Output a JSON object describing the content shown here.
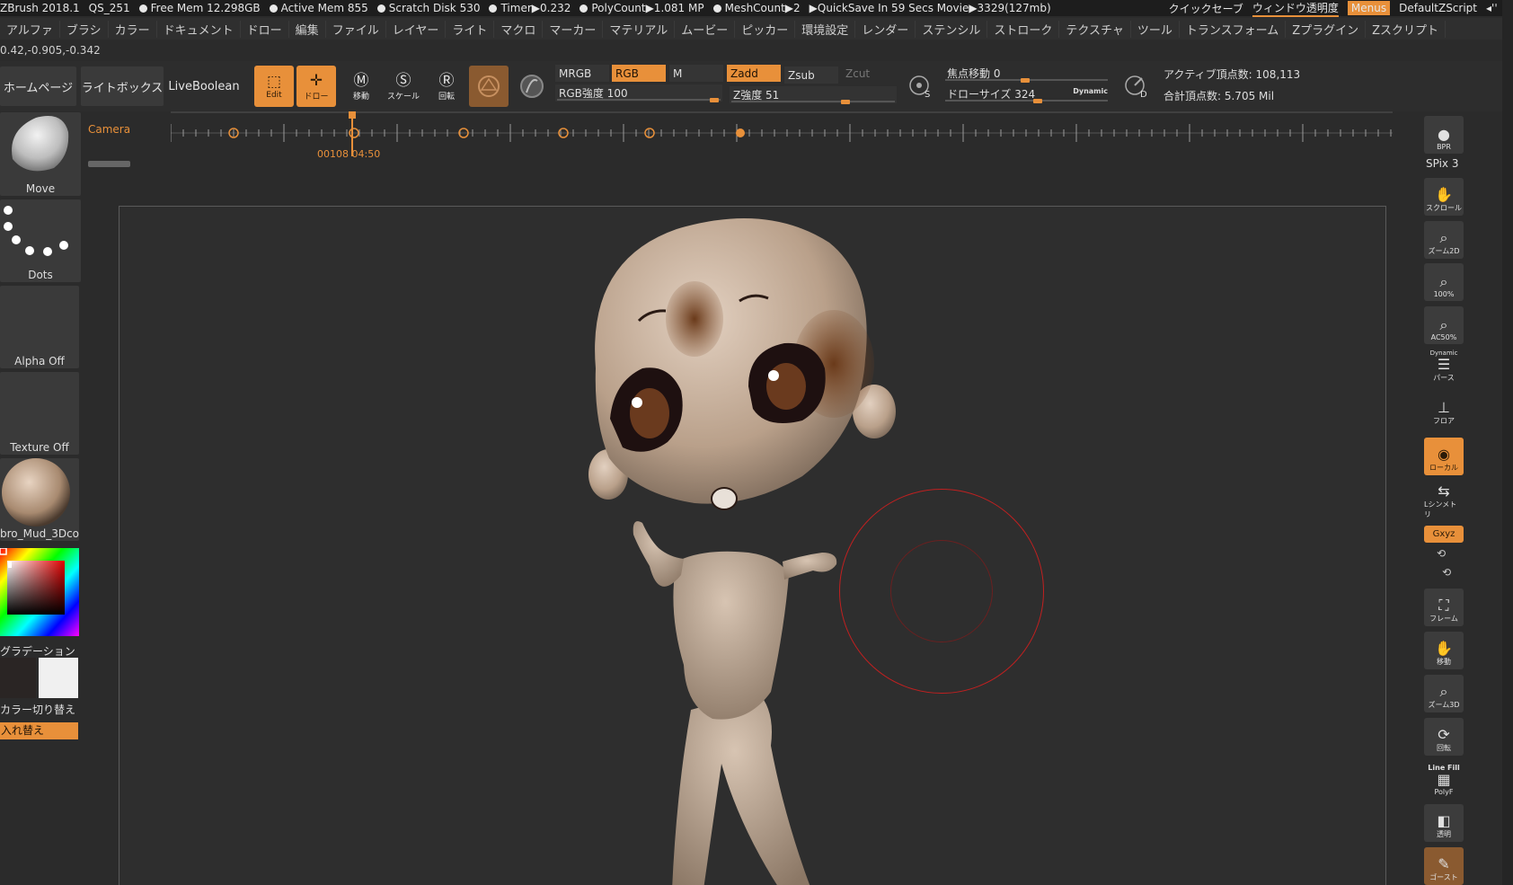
{
  "status": {
    "app": "ZBrush 2018.1",
    "doc": "QS_251",
    "items": [
      "Free Mem 12.298GB",
      "Active Mem 855",
      "Scratch Disk 530",
      "Timer▶0.232",
      "PolyCount▶1.081 MP",
      "MeshCount▶2"
    ],
    "quicksave": "▶QuickSave In 59 Secs Movie▶3329(127mb)",
    "right_quicksave": "クイックセーブ",
    "right_transparency": "ウィンドウ透明度",
    "right_menus": "Menus",
    "right_script": "DefaultZScript"
  },
  "menubar": {
    "items": [
      "アルファ",
      "ブラシ",
      "カラー",
      "ドキュメント",
      "ドロー",
      "編集",
      "ファイル",
      "レイヤー",
      "ライト",
      "マクロ",
      "マーカー",
      "マテリアル",
      "ムービー",
      "ピッカー",
      "環境設定",
      "レンダー",
      "ステンシル",
      "ストローク",
      "テクスチャ",
      "ツール",
      "トランスフォーム",
      "Zプラグイン",
      "Zスクリプト"
    ]
  },
  "coords": "0.42,-0.905,-0.342",
  "toolbar": {
    "home": "ホームページ",
    "lightbox": "ライトボックス",
    "liveboolean": "LiveBoolean",
    "edit": "Edit",
    "draw": "ドロー",
    "move": "移動",
    "scale": "スケール",
    "rotate": "回転",
    "mrgb": "MRGB",
    "rgb": "RGB",
    "m": "M",
    "zadd": "Zadd",
    "zsub": "Zsub",
    "zcut": "Zcut",
    "rgb_intensity": "RGB強度 100",
    "z_intensity": "Z強度 51",
    "focal_shift": "焦点移動 0",
    "draw_size": "ドローサイズ 324",
    "dynamic": "Dynamic",
    "active_points": "アクティブ頂点数: 108,113",
    "total_points": "合計頂点数: 5.705 Mil"
  },
  "timeline": {
    "label": "Camera",
    "time": "00108 04:50"
  },
  "left": {
    "brush": "Move",
    "stroke": "Dots",
    "alpha": "Alpha Off",
    "texture": "Texture Off",
    "material": "bro_Mud_3Dco",
    "gradient": "グラデーション",
    "color_switch": "カラー切り替え",
    "swap": "入れ替え"
  },
  "right": {
    "bpr": "BPR",
    "spix": "SPix 3",
    "scroll": "スクロール",
    "zoom2d": "ズーム2D",
    "actual": "100%",
    "aahalf": "AC50%",
    "persp_top": "Dynamic",
    "persp": "パース",
    "floor": "フロア",
    "local": "ローカル",
    "sym": "Lシンメトリ",
    "xyz": "Gxyz",
    "frame": "フレーム",
    "move": "移動",
    "zoom3d": "ズーム3D",
    "rotate": "回転",
    "linefill_top": "Line Fill",
    "linefill": "PolyF",
    "transp": "透明",
    "ghost": "ゴースト"
  },
  "colors": {
    "accent": "#e8903a",
    "bg": "#2b2b2b"
  }
}
